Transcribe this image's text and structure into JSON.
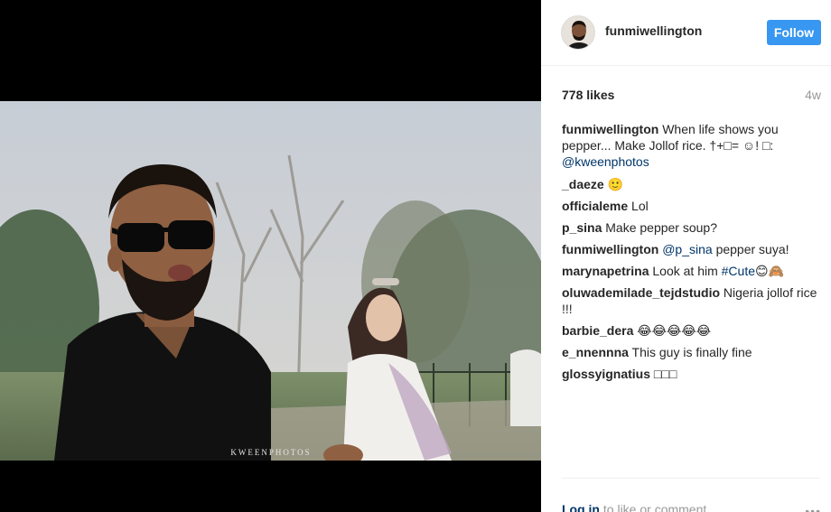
{
  "post": {
    "photo_watermark": "KWEENPHOTOS"
  },
  "header": {
    "username": "funmiwellington",
    "follow_label": "Follow"
  },
  "stats": {
    "likes": "778 likes",
    "age": "4w"
  },
  "caption": {
    "user": "funmiwellington",
    "text": "When life shows you pepper... Make Jollof rice. †+□= ☺! □: ",
    "mention": "@kweenphotos"
  },
  "comments": [
    {
      "user": "_daeze",
      "text": " 🙂"
    },
    {
      "user": "officialeme",
      "text": " Lol"
    },
    {
      "user": "p_sina",
      "text": " Make pepper soup?"
    },
    {
      "user": "funmiwellington",
      "mention": "@p_sina",
      "text": " pepper suya!"
    },
    {
      "user": "marynapetrina",
      "text": " Look at him ",
      "mention": "#Cute",
      "text2": "😊🙈"
    },
    {
      "user": "oluwademilade_tejdstudio",
      "text": " Nigeria jollof rice !!!"
    },
    {
      "user": "barbie_dera",
      "text": " 😂😂😂😂😂"
    },
    {
      "user": "e_nnennna",
      "text": " This guy is finally fine"
    },
    {
      "user": "glossyignatius",
      "text": " □□□"
    }
  ],
  "footer": {
    "login_label": "Log in",
    "rest": " to like or comment.",
    "more_icon": "more-horizontal-icon"
  }
}
